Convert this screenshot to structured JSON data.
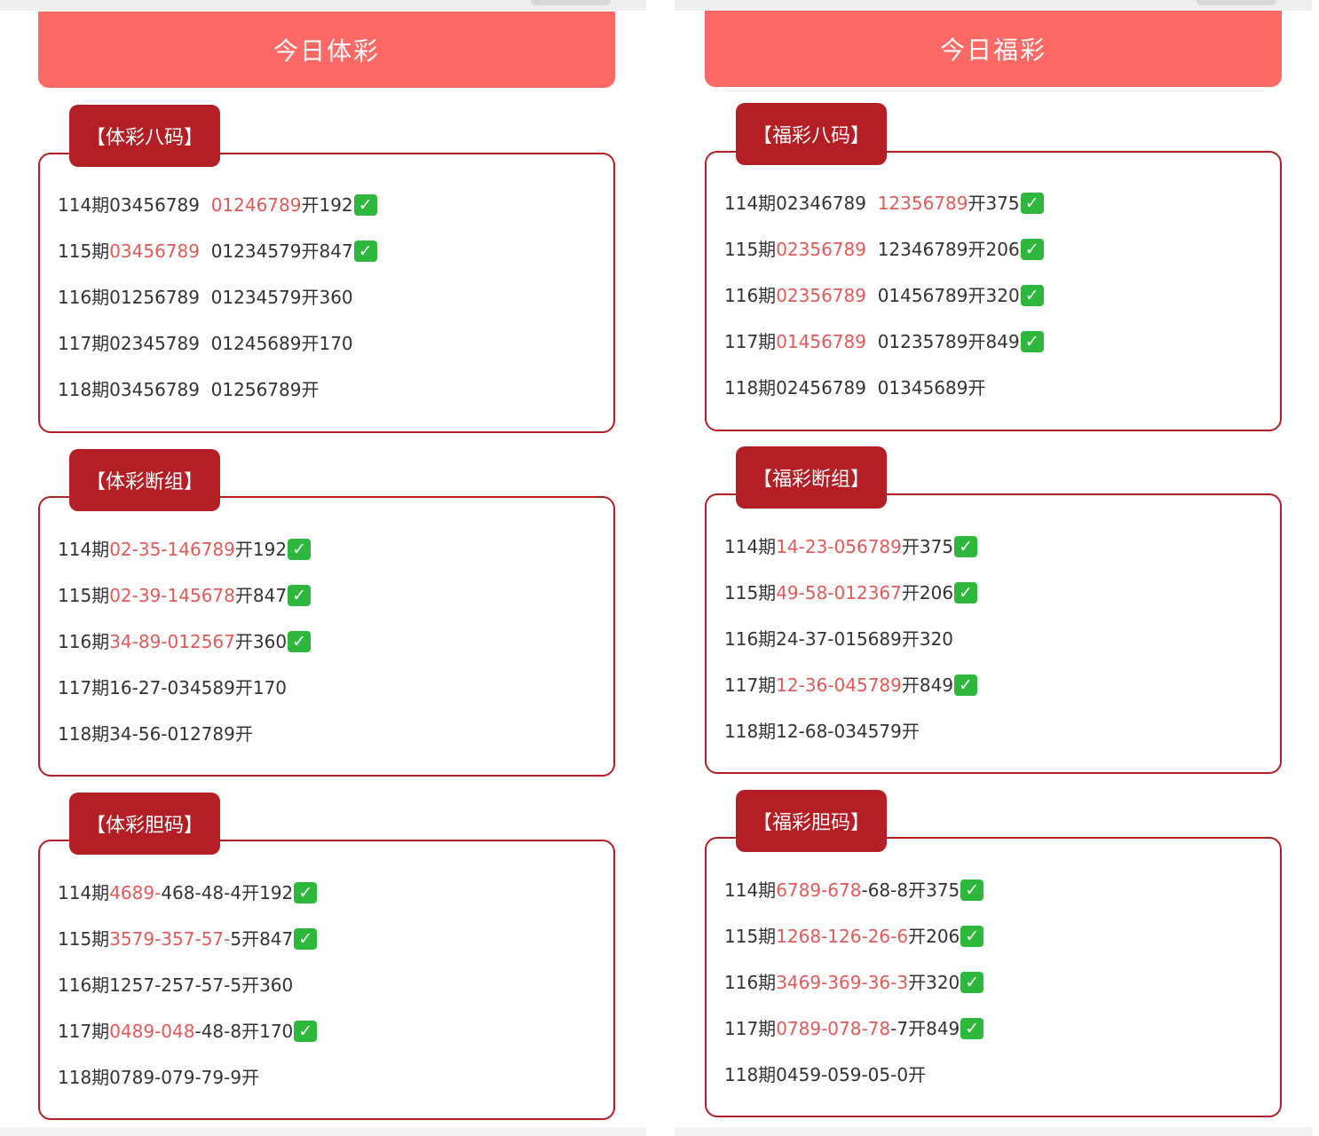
{
  "panels": [
    {
      "title": "今日体彩",
      "sections": [
        {
          "label": "【体彩八码】",
          "rows": [
            {
              "segs": [
                {
                  "t": "114期03456789  ",
                  "hi": false
                },
                {
                  "t": "01246789",
                  "hi": true
                },
                {
                  "t": "开192",
                  "hi": false
                }
              ],
              "check": true
            },
            {
              "segs": [
                {
                  "t": "115期",
                  "hi": false
                },
                {
                  "t": "03456789",
                  "hi": true
                },
                {
                  "t": "  01234579开847",
                  "hi": false
                }
              ],
              "check": true
            },
            {
              "segs": [
                {
                  "t": "116期01256789  01234579开360",
                  "hi": false
                }
              ],
              "check": false
            },
            {
              "segs": [
                {
                  "t": "117期02345789  01245689开170",
                  "hi": false
                }
              ],
              "check": false
            },
            {
              "segs": [
                {
                  "t": "118期03456789  01256789开",
                  "hi": false
                }
              ],
              "check": false
            }
          ]
        },
        {
          "label": "【体彩断组】",
          "rows": [
            {
              "segs": [
                {
                  "t": "114期",
                  "hi": false
                },
                {
                  "t": "02-35-146789",
                  "hi": true
                },
                {
                  "t": "开192",
                  "hi": false
                }
              ],
              "check": true
            },
            {
              "segs": [
                {
                  "t": "115期",
                  "hi": false
                },
                {
                  "t": "02-39-145678",
                  "hi": true
                },
                {
                  "t": "开847",
                  "hi": false
                }
              ],
              "check": true
            },
            {
              "segs": [
                {
                  "t": "116期",
                  "hi": false
                },
                {
                  "t": "34-89-012567",
                  "hi": true
                },
                {
                  "t": "开360",
                  "hi": false
                }
              ],
              "check": true
            },
            {
              "segs": [
                {
                  "t": "117期16-27-034589开170",
                  "hi": false
                }
              ],
              "check": false
            },
            {
              "segs": [
                {
                  "t": "118期34-56-012789开",
                  "hi": false
                }
              ],
              "check": false
            }
          ]
        },
        {
          "label": "【体彩胆码】",
          "rows": [
            {
              "segs": [
                {
                  "t": "114期",
                  "hi": false
                },
                {
                  "t": "4689-",
                  "hi": true
                },
                {
                  "t": "468-48-4开192",
                  "hi": false
                }
              ],
              "check": true
            },
            {
              "segs": [
                {
                  "t": "115期",
                  "hi": false
                },
                {
                  "t": "3579-357-57-",
                  "hi": true
                },
                {
                  "t": "5开847",
                  "hi": false
                }
              ],
              "check": true
            },
            {
              "segs": [
                {
                  "t": "116期1257-257-57-5开360",
                  "hi": false
                }
              ],
              "check": false
            },
            {
              "segs": [
                {
                  "t": "117期",
                  "hi": false
                },
                {
                  "t": "0489-048",
                  "hi": true
                },
                {
                  "t": "-48-8开170",
                  "hi": false
                }
              ],
              "check": true
            },
            {
              "segs": [
                {
                  "t": "118期0789-079-79-9开",
                  "hi": false
                }
              ],
              "check": false
            }
          ]
        }
      ]
    },
    {
      "title": "今日福彩",
      "sections": [
        {
          "label": "【福彩八码】",
          "rows": [
            {
              "segs": [
                {
                  "t": "114期02346789  ",
                  "hi": false
                },
                {
                  "t": "12356789",
                  "hi": true
                },
                {
                  "t": "开375",
                  "hi": false
                }
              ],
              "check": true
            },
            {
              "segs": [
                {
                  "t": "115期",
                  "hi": false
                },
                {
                  "t": "02356789",
                  "hi": true
                },
                {
                  "t": "  12346789开206",
                  "hi": false
                }
              ],
              "check": true
            },
            {
              "segs": [
                {
                  "t": "116期",
                  "hi": false
                },
                {
                  "t": "02356789",
                  "hi": true
                },
                {
                  "t": "  01456789开320",
                  "hi": false
                }
              ],
              "check": true
            },
            {
              "segs": [
                {
                  "t": "117期",
                  "hi": false
                },
                {
                  "t": "01456789",
                  "hi": true
                },
                {
                  "t": "  01235789开849",
                  "hi": false
                }
              ],
              "check": true
            },
            {
              "segs": [
                {
                  "t": "118期02456789  01345689开",
                  "hi": false
                }
              ],
              "check": false
            }
          ]
        },
        {
          "label": "【福彩断组】",
          "rows": [
            {
              "segs": [
                {
                  "t": "114期",
                  "hi": false
                },
                {
                  "t": "14-23-056789",
                  "hi": true
                },
                {
                  "t": "开375",
                  "hi": false
                }
              ],
              "check": true
            },
            {
              "segs": [
                {
                  "t": "115期",
                  "hi": false
                },
                {
                  "t": "49-58-012367",
                  "hi": true
                },
                {
                  "t": "开206",
                  "hi": false
                }
              ],
              "check": true
            },
            {
              "segs": [
                {
                  "t": "116期24-37-015689开320",
                  "hi": false
                }
              ],
              "check": false
            },
            {
              "segs": [
                {
                  "t": "117期",
                  "hi": false
                },
                {
                  "t": "12-36-045789",
                  "hi": true
                },
                {
                  "t": "开849",
                  "hi": false
                }
              ],
              "check": true
            },
            {
              "segs": [
                {
                  "t": "118期12-68-034579开",
                  "hi": false
                }
              ],
              "check": false
            }
          ]
        },
        {
          "label": "【福彩胆码】",
          "rows": [
            {
              "segs": [
                {
                  "t": "114期",
                  "hi": false
                },
                {
                  "t": "6789-678",
                  "hi": true
                },
                {
                  "t": "-68-8开375",
                  "hi": false
                }
              ],
              "check": true
            },
            {
              "segs": [
                {
                  "t": "115期",
                  "hi": false
                },
                {
                  "t": "1268-126-26-6",
                  "hi": true
                },
                {
                  "t": "开206",
                  "hi": false
                }
              ],
              "check": true
            },
            {
              "segs": [
                {
                  "t": "116期",
                  "hi": false
                },
                {
                  "t": "3469-369-36-3",
                  "hi": true
                },
                {
                  "t": "开320",
                  "hi": false
                }
              ],
              "check": true
            },
            {
              "segs": [
                {
                  "t": "117期",
                  "hi": false
                },
                {
                  "t": "0789-078-78",
                  "hi": true
                },
                {
                  "t": "-7开849",
                  "hi": false
                }
              ],
              "check": true
            },
            {
              "segs": [
                {
                  "t": "118期0459-059-05-0开",
                  "hi": false
                }
              ],
              "check": false
            }
          ]
        }
      ]
    }
  ],
  "icons": {
    "check": "check-mark-icon",
    "check_glyph": "✓"
  },
  "colors": {
    "banner": "#fe6865",
    "tag": "#b31f24",
    "highlight": "#e05a5a",
    "check": "#2db83d"
  }
}
